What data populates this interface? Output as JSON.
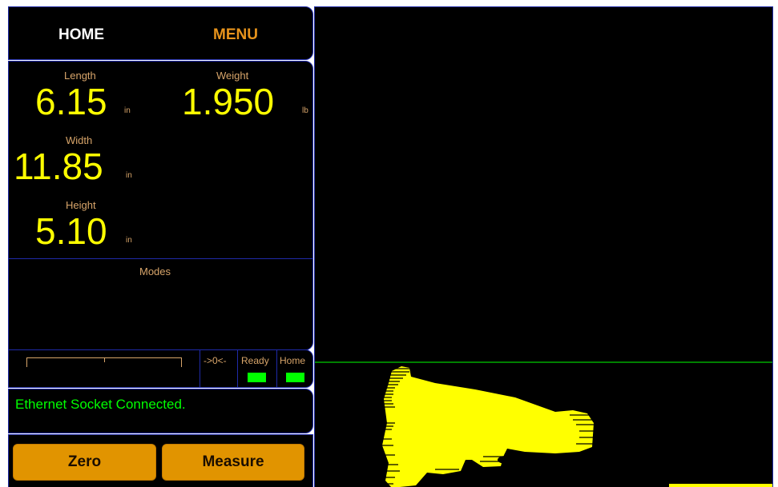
{
  "nav": {
    "home_label": "HOME",
    "menu_label": "MENU"
  },
  "measurements": {
    "length": {
      "label": "Length",
      "value": "6.15",
      "unit": "in"
    },
    "weight": {
      "label": "Weight",
      "value": "1.950",
      "unit": "lb"
    },
    "width": {
      "label": "Width",
      "value": "11.85",
      "unit": "in"
    },
    "height": {
      "label": "Height",
      "value": "5.10",
      "unit": "in"
    }
  },
  "modes": {
    "label": "Modes"
  },
  "status": {
    "zero_label": "->0<-",
    "ready_label": "Ready",
    "home_label": "Home",
    "ready_color": "#00ff00",
    "home_color": "#00ff00"
  },
  "message": {
    "text": "Ethernet Socket Connected.",
    "color": "#00ff00"
  },
  "actions": {
    "zero_label": "Zero",
    "measure_label": "Measure"
  },
  "colors": {
    "background": "#000000",
    "border": "#1f2aa8",
    "accent": "#e19400",
    "value": "#ffff00",
    "label": "#d8a56a",
    "scan": "#ffff00",
    "baseline": "#00aa00"
  }
}
